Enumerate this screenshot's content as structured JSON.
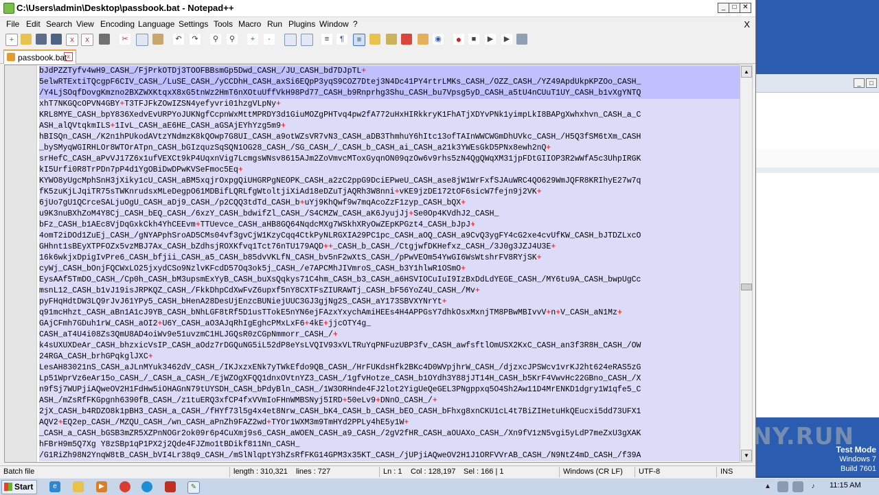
{
  "window": {
    "title": "C:\\Users\\admin\\Desktop\\passbook.bat - Notepad++",
    "min": "0",
    "max": "1",
    "close": "r"
  },
  "menu": {
    "items": [
      "File",
      "Edit",
      "Search",
      "View",
      "Encoding",
      "Language",
      "Settings",
      "Tools",
      "Macro",
      "Run",
      "Plugins",
      "Window",
      "?"
    ],
    "close_doc": "X"
  },
  "tab": {
    "label": "passbook.bat",
    "close": "x"
  },
  "editor": {
    "lines": [
      "bJdPZZTyfv4wH9_CASH_/FjPrkOTDj3TOOFBBsmGp5Dwd_CASH_/JU_CASH_bd7DJpTL+",
      "5elwRTExtiTQcgpF6CIV_CASH_/LuSE_CASH_/yCCDhH_CASH_axSi6EQpP3yqS9COZ7Dtej3N4Dc41PY4rtrLMKs_CASH_/OZZ_CASH_/YZ49ApdUkpKPZOo_CASH_",
      "/Y4LjSOqfDovgKmzno2BXZWXKtqxX8xG5tnWz2HmT6nXOtuUffVkH98Pd77_CASH_b9Rnprhg3Shu_CASH_bu7Vpsg5yD_CASH_a5tU4nCUuT1UY_CASH_b1vXgYNTQ",
      "xhT7NKGQcOPVN4GBY+T3TFJFkZOwIZSN4yefyvri01hzgVLpNy+",
      "KRL8MYE_CASH_bpY836XedvEvURPYoJUKNgfCcpnWxMttMPRDY3d1GiuMOZgPHTvq4pw2fA772uHxHIRkkryK1FhATjXDYvPNk1yimpLkI8BAPgXwhxhvn_CASH_a_C",
      "ASH_alQVtqkmILS+1IvL_CASH_aE6HE_CASH_aGSAjEYhYzg5m9+",
      "hBISQn_CASH_/K2n1hPUkodAVtzYNdmzK8kQOwp7G8UI_CASH_a9otWZsVR7vN3_CASH_aDB3ThmhuY6hItc13ofTAInWWCWGmDhUVkc_CASH_/H5Q3fSM6tXm_CASH",
      "_bySMyqWGIRHLOr8WTOrATpn_CASH_bGIzquzSqSQN1OG28_CASH_/SG_CASH_/_CASH_b_CASH_ai_CASH_a21k3YWEsGkD5PNx8ewh2nQ+",
      "srHefC_CASH_aPvVJ17Z6x1ufVEXCt9kP4UqxnVig7LcmgsWNsv8615AJm2ZoVmvcMToxGyqnON09qzOw6v9rhs5zN4QgQWqXM31jpFDtGIIOP3R2wWfA5c3UhpIRGK",
      "kI5Urfi0R8TrPDn7pP4d1YgOBiDwDPwKVSeFmoc5Eq+",
      "KYWO8yUgcMphSnH3jXiky1cU_CASH_aBM5xqjrOxpgQiUHGRPgNEOPK_CASH_a2zC2ppG9DciEPweU_CASH_ase8jW1WrFxfSJAuWRC4QO629WmJQFR8KRIhyE27w7q",
      "fK5zuKjLJqiTR75sTWKnrudsxMLeDegpO61MDBifLQRLfgWtoltjiXiAd18eDZuTjAQRh3W8nni+vKE9jzDE172tOF6sicW7fejn9j2VK+",
      "6jUo7gU1QCrceSALjuOgU_CASH_aDj9_CASH_/p2CQQ3tdTd_CASH_b+uYj9KhQwf9w7mqAcoZzF1zyp_CASH_bQX+",
      "u9K3nuBXhZoM4Y8Cj_CASH_bEQ_CASH_/6xzY_CASH_bdwifZl_CASH_/S4CMZW_CASH_aK6JyujJj+Se0Op4KVdhJ2_CASH_",
      "bFz_CASH_b1AEc8VjDqGxkCkh4YhCEEvm+TTUevce_CASH_aHB8GQ64NqdcMXg7WSkhXRyOwZEpKPGzt4_CASH_bJpJ+",
      "4omT2iDOd1ZuEj_CASH_/gNYAPphSroAD5CMs04vf3gvCjW1KzyCqq4CtkPyNLRGXIA29PC1pc_CASH_aOQ_CASH_a9CvQ3ygFY4cG2xe4cvUfKW_CASH_bJTDZLxcO",
      "GHhnt1sBEyXTPFOZx5vzMBJ7Ax_CASH_bZdhsjROXKfvq1Tct76nTU179AQD++_CASH_b_CASH_/CtgjwfDKHefxz_CASH_/3J0g3JZJ4U3E+",
      "16k6wkjxDpigIvPre6_CASH_bfjii_CASH_a5_CASH_b85dvVKLfN_CASH_bv5nF2wXtS_CASH_/pPwVEOm54YwGI6WsWtshrFV8RYjSK+",
      "cyWj_CASH_bOnjFQCWxLO25jxydCSo9NzlvKFcdD57Oq3ok5j_CASH_/e7APCMhJIVmroS_CASH_b3Y1hlwR1OSmO+",
      "EysAAf5TmDO_CASH_/Cp0h_CASH_bM3upsmExYyB_CASH_buXsQqkys71C4hm_CASH_b3_CASH_a6HSVIOCuIuI9IzBxDdLdYEGE_CASH_/MY6tu9A_CASH_bwpUgCc",
      "msnL12_CASH_b1vJ19isJRPKQZ_CASH_/FkkDhpCdXwFvZ6upxf5nY8CXTFsZIURAWTj_CASH_bF56YoZ4U_CASH_/Mv+",
      "pyFHqHdtDW3LQ9rJvJ61YPy5_CASH_bHenA28DesUjEnzcBUNiejUUC3GJ3gjNg2S_CASH_aY173SBVXYNrYt+",
      "q91mcHhzt_CASH_aBn1A1cJ9YB_CASH_bNhLGF8tRf5D1usTTokE5nYN6ejFAzxYxychAmiHEEs4H4APPGsY7dhkOsxMxnjTM8PBwMBIvvV+n+V_CASH_aN1Mz+",
      "GAjCFmh7GDuh1rW_CASH_aOI2+U6Y_CASH_aO3AJqRhIgEghcPMxLxF6+4kE+jjcOTY4g_",
      "CASH_aT4U4i08Zs3QmU8AD4oiWv9e51uvzmC1HLJGQsR0zCGpNmmorr_CASH_/+",
      "k4sUXUXDeAr_CASH_bhzxicVsIP_CASH_aOdz7rDGQuNG5iL52dP8eYsLVQIV93xVLTRuYqPNFuzUBP3fv_CASH_awfsftlOmUSX2KxC_CASH_an3f3R8H_CASH_/OW",
      "24RGA_CASH_brhGPqkglJXC+",
      "LesAH83021nS_CASH_aJLnMYuk3462dV_CASH_/IKJxzxENk7yTWkEfdo9QB_CASH_/HrFUKdsHfk2BKc4D0WVpjhrW_CASH_/djzxcJPSWcv1vrKJ2ht624eRAS5zG",
      "Lp51WprVz6eAr15o_CASH_/_CASH_a_CASH_/EjWZOgXFQQ1dnxOVtnYZ3_CASH_/1gfvHotze_CASH_b1OYdh3Y88jJT14H_CASH_b5KrF4VwvHc22GBno_CASH_/X",
      "n9fSj7WUPjiAQweOV2H1FdHw5iOHAGnN79tUYSDH_CASH_bPdyBln_CASH_/1W3ORHnde4FJ2lot2YigUeQeGEL3PNgppxq5O4Sh2Aw11D4MrENKD1dgry1W1qfe5_C",
      "ASH_/mZsRfFKGpgnh6390fB_CASH_/z1tuERQ3xfCP4fxVVmIoFHnWMBSNyj5IRD+50eLv9+DNnO_CASH_/+",
      "2jX_CASH_b4RDZO8k1pBH3_CASH_a_CASH_/fHYf73l5g4x4et8Nrw_CASH_bK4_CASH_b_CASH_bEO_CASH_bFhxg8xnCKU1cL4t7BiZIHetuHkQEucxi5dd73UFX1",
      "AQV2+EQ2ep_CASH_/MZQU_CASH_/wn_CASH_aPnZh9FAZ2wd+TYOr1WXM3m9TmHYd2PPLy4hE5y1W+",
      "_CASH_a_CASH_bGSB3mZR5XZPnNOGr2ok09r6p4CuXmj9s6_CASH_aWOEN_CASH_a9_CASH_/2gV2fHR_CASH_aOUAXo_CASH_/Xn9fV1zN5vgi5yLdP7meZxU3gXAK",
      "hFBrH9m5Q7Xg Y8zSBp1qP1PX2j2Qde4FJZmo1tBDikf811Nn_CASH_",
      "/G1RiZh98N2YnqW8tB_CASH_bVI4Lr38q9_CASH_/mSlNlqptY3hZsRfFKG14GPM3x35KT_CASH_/jUPjiAQweOV2H1J1ORFVVrAB_CASH_/N9NtZ4mD_CASH_/f39A"
    ]
  },
  "status": {
    "type": "Batch file",
    "length": "length : 310,321",
    "lines": "lines : 727",
    "ln": "Ln : 1",
    "col": "Col : 128,197",
    "sel": "Sel : 166 | 1",
    "eol": "Windows (CR LF)",
    "enc": "UTF-8",
    "ins": "INS"
  },
  "taskbar": {
    "start": "Start",
    "time": "11:15 AM"
  },
  "desktop": {
    "watermark": "ANY.RUN",
    "test1": "Test Mode",
    "test2": "Windows 7",
    "test3": "Build 7601"
  }
}
